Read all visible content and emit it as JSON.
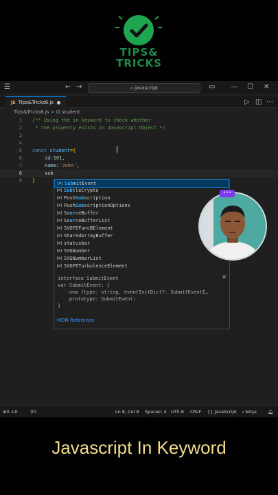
{
  "logo": {
    "text_line1": "TIPS&",
    "text_line2": "TRICKS",
    "accent_color": "#1ea54f"
  },
  "titlebar": {
    "search_placeholder": "javascript",
    "menu_icon": "hamburger-icon"
  },
  "tab": {
    "badge": "JS",
    "label": "Tips&Tricks6.js"
  },
  "breadcrumb": {
    "file": "Tips&Tricks6.js",
    "separator": ">",
    "symbol": "student"
  },
  "code_lines": [
    {
      "n": "1",
      "text": "/** Using the in keyword to check whether"
    },
    {
      "n": "2",
      "text": " * the property exists in Javascript Object */"
    },
    {
      "n": "3",
      "text": ""
    },
    {
      "n": "4",
      "text": ""
    },
    {
      "n": "5",
      "kw": "const",
      "var": "student",
      "rest": "={"
    },
    {
      "n": "6",
      "prop": "id",
      "colon": ":",
      "num": "101",
      "end": ","
    },
    {
      "n": "7",
      "prop": "name",
      "colon": ":",
      "str": "'John'",
      "end": ","
    },
    {
      "n": "8",
      "typed": "sub"
    },
    {
      "n": "9",
      "text": "}"
    }
  ],
  "suggestions": [
    {
      "pre": "",
      "match": "Sub",
      "post": "mitEvent",
      "selected": true
    },
    {
      "pre": "",
      "match": "Sub",
      "post": "tleCrypto"
    },
    {
      "pre": "Push",
      "match": "Sub",
      "post": "scription"
    },
    {
      "pre": "Push",
      "match": "Sub",
      "post": "scriptionOptions"
    },
    {
      "pre": "So",
      "match": "u",
      "post": "rceBuffer"
    },
    {
      "pre": "So",
      "match": "u",
      "post": "rceBufferList"
    },
    {
      "pre": "SVGFEFuncBElement",
      "match": "",
      "post": ""
    },
    {
      "pre": "SharedArrayBuffer",
      "match": "",
      "post": ""
    },
    {
      "pre": "statusbar",
      "match": "",
      "post": ""
    },
    {
      "pre": "SVGNumber",
      "match": "",
      "post": ""
    },
    {
      "pre": "SVGNumberList",
      "match": "",
      "post": ""
    },
    {
      "pre": "SVGFETurbulenceElement",
      "match": "",
      "post": ""
    }
  ],
  "details": {
    "lines": [
      "interface SubmitEvent",
      "var SubmitEvent: {",
      "    new (type: string, eventInitDict?: SubmitEventI…",
      "    prototype: SubmitEvent;",
      "}"
    ],
    "link": "MDN Reference",
    "close": "×"
  },
  "webcam": {
    "badge": "•••"
  },
  "status": {
    "errors": "0",
    "warnings": "0",
    "ports": "0",
    "position": "Ln 8, Col 8",
    "spaces": "Spaces: 4",
    "encoding": "UTF-8",
    "eol": "CRLF",
    "language": "{} JavaScript",
    "ninja": "Ninja"
  },
  "caption": "Javascript In Keyword"
}
